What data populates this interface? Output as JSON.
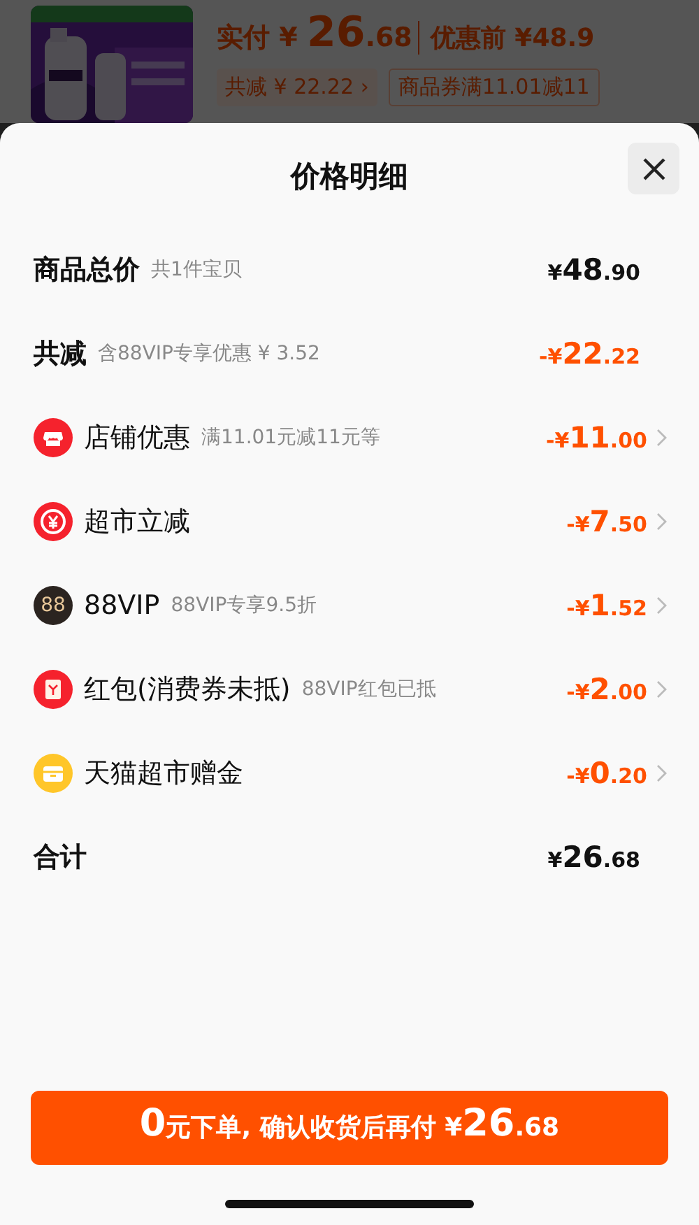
{
  "product": {
    "kind": "picture",
    "paid_label": "实付",
    "paid_currency": "¥",
    "paid_main": "26",
    "paid_minor": ".68",
    "original_price": "优惠前 ¥48.9",
    "chips": [
      {
        "kind": "filled",
        "text": "共减 ¥ 22.22",
        "arrow": "›"
      },
      {
        "kind": "outline",
        "text": "商品券满11.01减11"
      }
    ]
  },
  "sheet": {
    "title": "价格明细",
    "rows": [
      {
        "kind": "summary",
        "label": "商品总价",
        "note": "共1件宝贝",
        "prefix": "¥",
        "main": "48",
        "minor": ".90"
      },
      {
        "kind": "reduction",
        "label": "共减",
        "note": "含88VIP专享优惠 ¥ 3.52",
        "prefix": "-¥",
        "main": "22",
        "minor": ".22"
      },
      {
        "kind": "store",
        "label": "店铺优惠",
        "note": "满11.01元减11元等",
        "prefix": "-¥",
        "main": "11",
        "minor": ".00"
      },
      {
        "kind": "yen",
        "label": "超市立减",
        "prefix": "-¥",
        "main": "7",
        "minor": ".50"
      },
      {
        "kind": "vip",
        "badge": "88",
        "label": "88VIP",
        "note": "88VIP专享9.5折",
        "prefix": "-¥",
        "main": "1",
        "minor": ".52"
      },
      {
        "kind": "packet",
        "label": "红包(消费券未抵)",
        "note": "88VIP红包已抵",
        "prefix": "-¥",
        "main": "2",
        "minor": ".00"
      },
      {
        "kind": "gift",
        "label": "天猫超市赠金",
        "prefix": "-¥",
        "main": "0",
        "minor": ".20"
      },
      {
        "kind": "total",
        "label": "合计",
        "prefix": "¥",
        "main": "26",
        "minor": ".68"
      }
    ],
    "button": [
      {
        "kind": "large",
        "text": "0"
      },
      {
        "kind": "small",
        "text": "元下单, 确认收货后再付 ¥"
      },
      {
        "kind": "large",
        "text": "26"
      },
      {
        "kind": "small",
        "text": ".68"
      }
    ]
  }
}
